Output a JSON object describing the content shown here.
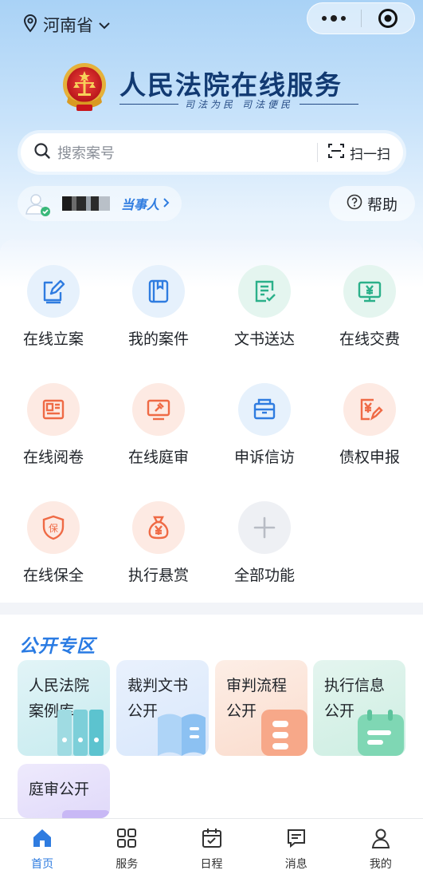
{
  "location": {
    "label": "河南省"
  },
  "app": {
    "title": "人民法院在线服务",
    "motto_left": "司法为民",
    "motto_right": "司法便民"
  },
  "search": {
    "placeholder": "搜索案号",
    "scan_label": "扫一扫"
  },
  "user": {
    "role": "当事人"
  },
  "help": {
    "label": "帮助"
  },
  "services": [
    {
      "label": "在线立案",
      "icon": "file-edit-icon",
      "color": "#2f7ce0"
    },
    {
      "label": "我的案件",
      "icon": "case-book-icon",
      "color": "#2f7ce0"
    },
    {
      "label": "文书送达",
      "icon": "document-check-icon",
      "color": "#2bb08a"
    },
    {
      "label": "在线交费",
      "icon": "payment-screen-icon",
      "color": "#2bb08a"
    },
    {
      "label": "在线阅卷",
      "icon": "newspaper-icon",
      "color": "#ef6a45"
    },
    {
      "label": "在线庭审",
      "icon": "gavel-screen-icon",
      "color": "#ef6a45"
    },
    {
      "label": "申诉信访",
      "icon": "mailbox-icon",
      "color": "#2f7ce0"
    },
    {
      "label": "债权申报",
      "icon": "yuan-pen-icon",
      "color": "#ef6a45"
    },
    {
      "label": "在线保全",
      "icon": "shield-icon",
      "color": "#ef6a45"
    },
    {
      "label": "执行悬赏",
      "icon": "money-bag-icon",
      "color": "#ef6a45"
    },
    {
      "label": "全部功能",
      "icon": "plus-icon",
      "color": "#b8bcc4"
    }
  ],
  "public_zone": {
    "title": "公开专区",
    "cards": [
      {
        "line1": "人民法院",
        "line2": "案例库"
      },
      {
        "line1": "裁判文书",
        "line2": "公开"
      },
      {
        "line1": "审判流程",
        "line2": "公开"
      },
      {
        "line1": "执行信息",
        "line2": "公开"
      },
      {
        "line1": "庭审公开",
        "line2": ""
      }
    ]
  },
  "tabbar": [
    {
      "label": "首页",
      "icon": "home-icon",
      "active": true
    },
    {
      "label": "服务",
      "icon": "grid-icon",
      "active": false
    },
    {
      "label": "日程",
      "icon": "calendar-icon",
      "active": false
    },
    {
      "label": "消息",
      "icon": "message-icon",
      "active": false
    },
    {
      "label": "我的",
      "icon": "user-icon",
      "active": false
    }
  ],
  "colors": {
    "accent": "#2f7ce0",
    "title": "#123a72",
    "orange": "#ef6a45",
    "green": "#2bb08a"
  }
}
